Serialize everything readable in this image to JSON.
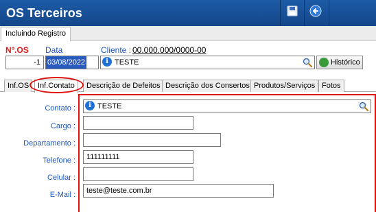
{
  "window": {
    "title": "OS Terceiros"
  },
  "toolbar": {
    "save_icon": "save-icon",
    "back_icon": "back-icon"
  },
  "subtab": {
    "label": "Incluindo Registro"
  },
  "header": {
    "os_label": "Nº.OS",
    "os_value": "-1",
    "data_label": "Data",
    "data_value": "03/08/2022",
    "cliente_label": "Cliente :",
    "cliente_code": "00.000.000/0000-00",
    "cliente_value": "TESTE",
    "historico_label": "Histórico"
  },
  "tabs": [
    {
      "label": "Inf.OS"
    },
    {
      "label": "Inf.Contato"
    },
    {
      "label": "Descrição de Defeitos"
    },
    {
      "label": "Descrição dos Consertos"
    },
    {
      "label": "Produtos/Serviços"
    },
    {
      "label": "Fotos"
    }
  ],
  "form": {
    "contato_label": "Contato :",
    "contato_value": "TESTE",
    "cargo_label": "Cargo :",
    "cargo_value": "",
    "departamento_label": "Departamento :",
    "departamento_value": "",
    "telefone_label": "Telefone :",
    "telefone_value": "111111111",
    "celular_label": "Celular :",
    "celular_value": "",
    "email_label": "E-Mail :",
    "email_value": "teste@teste.com.br"
  },
  "colors": {
    "titlebar": "#1d5ba6",
    "highlight": "#e01212",
    "label_blue": "#1e56b8",
    "label_red": "#e01b1b"
  }
}
